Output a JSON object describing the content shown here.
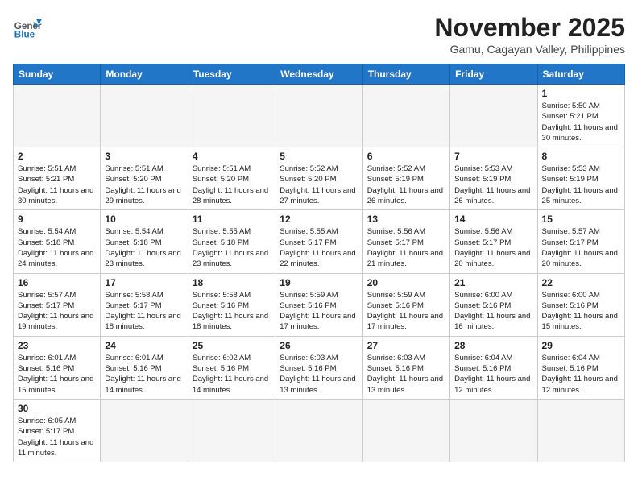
{
  "header": {
    "logo_general": "General",
    "logo_blue": "Blue",
    "month_title": "November 2025",
    "location": "Gamu, Cagayan Valley, Philippines"
  },
  "weekdays": [
    "Sunday",
    "Monday",
    "Tuesday",
    "Wednesday",
    "Thursday",
    "Friday",
    "Saturday"
  ],
  "days": {
    "d1": {
      "num": "1",
      "sunrise": "5:50 AM",
      "sunset": "5:21 PM",
      "daylight": "11 hours and 30 minutes."
    },
    "d2": {
      "num": "2",
      "sunrise": "5:51 AM",
      "sunset": "5:21 PM",
      "daylight": "11 hours and 30 minutes."
    },
    "d3": {
      "num": "3",
      "sunrise": "5:51 AM",
      "sunset": "5:20 PM",
      "daylight": "11 hours and 29 minutes."
    },
    "d4": {
      "num": "4",
      "sunrise": "5:51 AM",
      "sunset": "5:20 PM",
      "daylight": "11 hours and 28 minutes."
    },
    "d5": {
      "num": "5",
      "sunrise": "5:52 AM",
      "sunset": "5:20 PM",
      "daylight": "11 hours and 27 minutes."
    },
    "d6": {
      "num": "6",
      "sunrise": "5:52 AM",
      "sunset": "5:19 PM",
      "daylight": "11 hours and 26 minutes."
    },
    "d7": {
      "num": "7",
      "sunrise": "5:53 AM",
      "sunset": "5:19 PM",
      "daylight": "11 hours and 26 minutes."
    },
    "d8": {
      "num": "8",
      "sunrise": "5:53 AM",
      "sunset": "5:19 PM",
      "daylight": "11 hours and 25 minutes."
    },
    "d9": {
      "num": "9",
      "sunrise": "5:54 AM",
      "sunset": "5:18 PM",
      "daylight": "11 hours and 24 minutes."
    },
    "d10": {
      "num": "10",
      "sunrise": "5:54 AM",
      "sunset": "5:18 PM",
      "daylight": "11 hours and 23 minutes."
    },
    "d11": {
      "num": "11",
      "sunrise": "5:55 AM",
      "sunset": "5:18 PM",
      "daylight": "11 hours and 23 minutes."
    },
    "d12": {
      "num": "12",
      "sunrise": "5:55 AM",
      "sunset": "5:17 PM",
      "daylight": "11 hours and 22 minutes."
    },
    "d13": {
      "num": "13",
      "sunrise": "5:56 AM",
      "sunset": "5:17 PM",
      "daylight": "11 hours and 21 minutes."
    },
    "d14": {
      "num": "14",
      "sunrise": "5:56 AM",
      "sunset": "5:17 PM",
      "daylight": "11 hours and 20 minutes."
    },
    "d15": {
      "num": "15",
      "sunrise": "5:57 AM",
      "sunset": "5:17 PM",
      "daylight": "11 hours and 20 minutes."
    },
    "d16": {
      "num": "16",
      "sunrise": "5:57 AM",
      "sunset": "5:17 PM",
      "daylight": "11 hours and 19 minutes."
    },
    "d17": {
      "num": "17",
      "sunrise": "5:58 AM",
      "sunset": "5:17 PM",
      "daylight": "11 hours and 18 minutes."
    },
    "d18": {
      "num": "18",
      "sunrise": "5:58 AM",
      "sunset": "5:16 PM",
      "daylight": "11 hours and 18 minutes."
    },
    "d19": {
      "num": "19",
      "sunrise": "5:59 AM",
      "sunset": "5:16 PM",
      "daylight": "11 hours and 17 minutes."
    },
    "d20": {
      "num": "20",
      "sunrise": "5:59 AM",
      "sunset": "5:16 PM",
      "daylight": "11 hours and 17 minutes."
    },
    "d21": {
      "num": "21",
      "sunrise": "6:00 AM",
      "sunset": "5:16 PM",
      "daylight": "11 hours and 16 minutes."
    },
    "d22": {
      "num": "22",
      "sunrise": "6:00 AM",
      "sunset": "5:16 PM",
      "daylight": "11 hours and 15 minutes."
    },
    "d23": {
      "num": "23",
      "sunrise": "6:01 AM",
      "sunset": "5:16 PM",
      "daylight": "11 hours and 15 minutes."
    },
    "d24": {
      "num": "24",
      "sunrise": "6:01 AM",
      "sunset": "5:16 PM",
      "daylight": "11 hours and 14 minutes."
    },
    "d25": {
      "num": "25",
      "sunrise": "6:02 AM",
      "sunset": "5:16 PM",
      "daylight": "11 hours and 14 minutes."
    },
    "d26": {
      "num": "26",
      "sunrise": "6:03 AM",
      "sunset": "5:16 PM",
      "daylight": "11 hours and 13 minutes."
    },
    "d27": {
      "num": "27",
      "sunrise": "6:03 AM",
      "sunset": "5:16 PM",
      "daylight": "11 hours and 13 minutes."
    },
    "d28": {
      "num": "28",
      "sunrise": "6:04 AM",
      "sunset": "5:16 PM",
      "daylight": "11 hours and 12 minutes."
    },
    "d29": {
      "num": "29",
      "sunrise": "6:04 AM",
      "sunset": "5:16 PM",
      "daylight": "11 hours and 12 minutes."
    },
    "d30": {
      "num": "30",
      "sunrise": "6:05 AM",
      "sunset": "5:17 PM",
      "daylight": "11 hours and 11 minutes."
    }
  }
}
